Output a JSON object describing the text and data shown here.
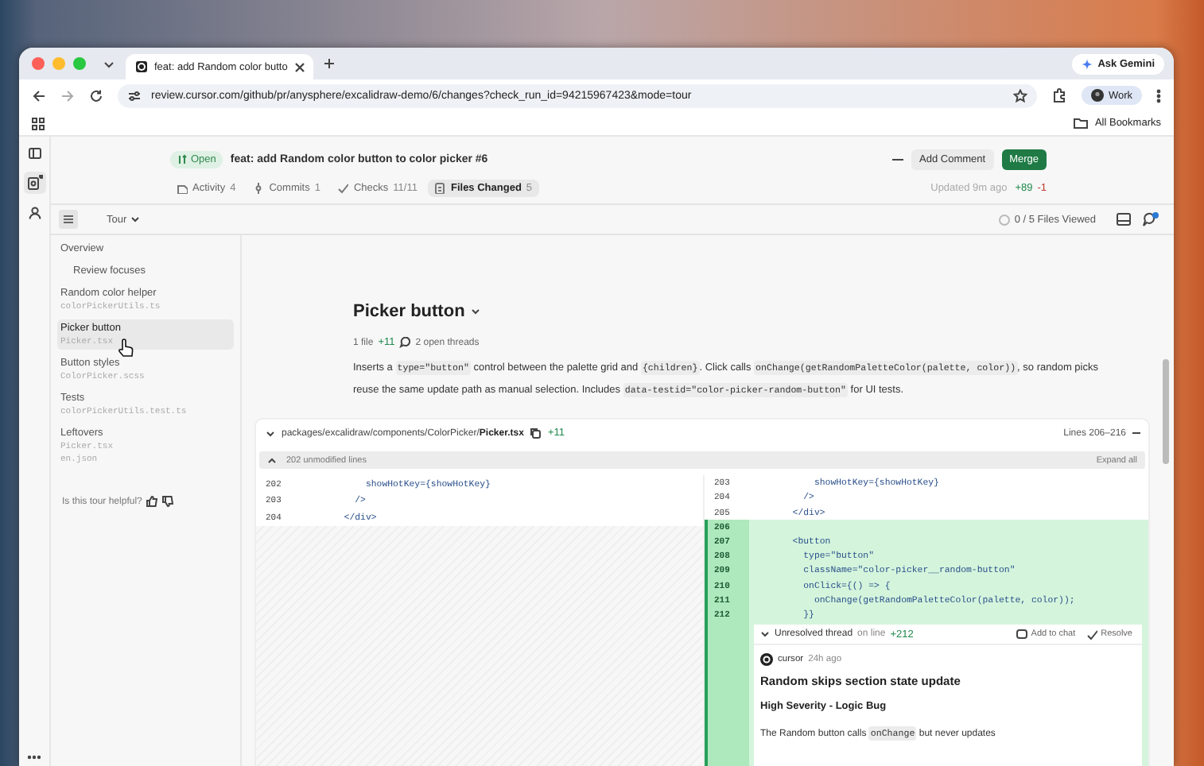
{
  "browser": {
    "tab_title": "feat: add Random color butto",
    "url": "review.cursor.com/github/pr/anysphere/excalidraw-demo/6/changes?check_run_id=94215967423&mode=tour",
    "profile": "Work",
    "assistant": "Ask Gemini",
    "bookmarks": "All Bookmarks"
  },
  "pr": {
    "status": "Open",
    "title": "feat: add Random color button to color picker #6",
    "add_comment": "Add Comment",
    "merge": "Merge",
    "updated": "Updated 9m ago",
    "additions": "+89",
    "deletions": "-1",
    "tabs": [
      {
        "kind": "activity",
        "label": "Activity",
        "count": "4",
        "selected": false
      },
      {
        "kind": "commits",
        "label": "Commits",
        "count": "1",
        "selected": false
      },
      {
        "kind": "checks",
        "label": "Checks",
        "count": "11/11",
        "selected": false
      },
      {
        "kind": "files",
        "label": "Files Changed",
        "count": "5",
        "selected": true
      }
    ]
  },
  "toolbar": {
    "mode": "Tour",
    "files_viewed": "0 / 5 Files Viewed"
  },
  "sidebar": {
    "items": [
      {
        "label": "Overview",
        "selected": false,
        "children": [
          {
            "label": "Review focuses",
            "selected": false
          }
        ]
      },
      {
        "label": "Random color helper",
        "files": [
          "colorPickerUtils.ts"
        ],
        "selected": false
      },
      {
        "label": "Picker button",
        "files": [
          "Picker.tsx"
        ],
        "selected": true
      },
      {
        "label": "Button styles",
        "files": [
          "ColorPicker.scss"
        ],
        "selected": false
      },
      {
        "label": "Tests",
        "files": [
          "colorPickerUtils.test.ts"
        ],
        "selected": false
      },
      {
        "label": "Leftovers",
        "files": [
          "Picker.tsx",
          "en.json"
        ],
        "selected": false
      }
    ],
    "feedback": "Is this tour helpful?"
  },
  "section": {
    "title": "Picker button",
    "files": "1 file",
    "additions": "+11",
    "threads": "2 open threads",
    "description": [
      {
        "kind": "text",
        "text": "Inserts a "
      },
      {
        "kind": "code",
        "text": "type=\"button\""
      },
      {
        "kind": "text",
        "text": " control between the palette grid and "
      },
      {
        "kind": "code",
        "text": "{children}"
      },
      {
        "kind": "text",
        "text": ". Click calls "
      },
      {
        "kind": "code",
        "text": "onChange(getRandomPaletteColor(palette, color))"
      },
      {
        "kind": "text",
        "text": ", so random picks reuse the same update path as manual selection. Includes "
      },
      {
        "kind": "code",
        "text": "data-testid=\"color-picker-random-button\""
      },
      {
        "kind": "text",
        "text": " for UI tests."
      }
    ]
  },
  "diff": {
    "dir": "packages/excalidraw/components/ColorPicker/",
    "file": "Picker.tsx",
    "additions": "+11",
    "range": "Lines 206–216",
    "collapsed": "202 unmodified lines",
    "expand": "Expand all",
    "left": [
      {
        "num": "202",
        "code": "            showHotKey={showHotKey}"
      },
      {
        "num": "203",
        "code": "          />"
      },
      {
        "num": "204",
        "code": "        </div>"
      }
    ],
    "right": [
      {
        "num": "203",
        "code": "            showHotKey={showHotKey}",
        "added": false
      },
      {
        "num": "204",
        "code": "          />",
        "added": false
      },
      {
        "num": "205",
        "code": "        </div>",
        "added": false
      },
      {
        "num": "206",
        "added": true
      },
      {
        "num": "207",
        "code": "        <button",
        "added": true
      },
      {
        "num": "208",
        "code": "          type=\"button\"",
        "added": true
      },
      {
        "num": "209",
        "code": "          className=\"color-picker__random-button\"",
        "added": true
      },
      {
        "num": "210",
        "code": "          onClick={() => {",
        "added": true
      },
      {
        "num": "211",
        "code": "            onChange(getRandomPaletteColor(palette, color));",
        "added": true
      },
      {
        "num": "212",
        "code": "          }}",
        "added": true
      }
    ],
    "thread": {
      "title": "Unresolved thread",
      "on_line": "on line",
      "line": "+212",
      "add_to_chat": "Add to chat",
      "resolve": "Resolve",
      "author": "cursor",
      "time": "24h ago",
      "heading": "Random skips section state update",
      "severity": "High Severity - Logic Bug",
      "body": [
        {
          "kind": "text",
          "text": "The Random button calls "
        },
        {
          "kind": "code",
          "text": "onChange"
        },
        {
          "kind": "text",
          "text": " but never updates"
        }
      ]
    }
  }
}
